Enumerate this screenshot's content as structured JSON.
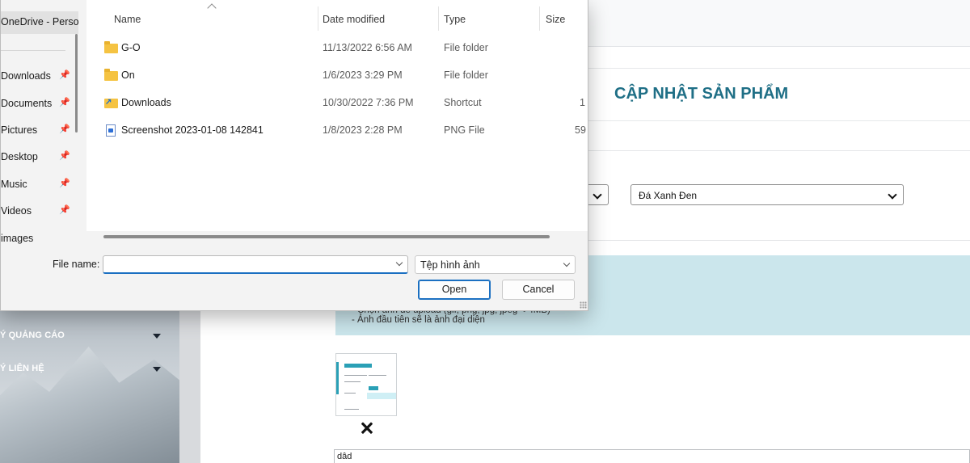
{
  "background": {
    "sidebar": {
      "items": [
        {
          "label": "Ý QUẢNG CÁO"
        },
        {
          "label": "Ý LIÊN HỆ"
        }
      ]
    },
    "page_title": "CẬP NHẬT SẢN PHẨM",
    "select_left": {
      "value": ""
    },
    "select_color": {
      "value": "Đá Xanh Đen"
    },
    "info_box": {
      "line1": "- Chọn ảnh để upload (gif, png, jpg, jpeg < 4MB)",
      "line2": "- Ảnh đầu tiên sẽ là ảnh đại diện"
    },
    "delete_symbol": "🗙",
    "text_field": {
      "value": "dâd"
    }
  },
  "dialog": {
    "nav": {
      "items": [
        {
          "label": "OneDrive - Perso",
          "pinned": false,
          "selected": true
        },
        {
          "label": "Downloads",
          "pinned": true
        },
        {
          "label": "Documents",
          "pinned": true
        },
        {
          "label": "Pictures",
          "pinned": true
        },
        {
          "label": "Desktop",
          "pinned": true
        },
        {
          "label": "Music",
          "pinned": true
        },
        {
          "label": "Videos",
          "pinned": true
        },
        {
          "label": "images",
          "pinned": false
        }
      ]
    },
    "columns": {
      "name": "Name",
      "date": "Date modified",
      "type": "Type",
      "size": "Size"
    },
    "files": [
      {
        "icon": "folder-icon",
        "name": "G-O",
        "date": "11/13/2022 6:56 AM",
        "type": "File folder",
        "size": ""
      },
      {
        "icon": "folder-icon",
        "name": "On",
        "date": "1/6/2023 3:29 PM",
        "type": "File folder",
        "size": ""
      },
      {
        "icon": "shortcut-icon",
        "name": "Downloads",
        "date": "10/30/2022 7:36 PM",
        "type": "Shortcut",
        "size": "1"
      },
      {
        "icon": "png-file-icon",
        "name": "Screenshot 2023-01-08 142841",
        "date": "1/8/2023 2:28 PM",
        "type": "PNG File",
        "size": "59"
      }
    ],
    "file_name_label": "File name:",
    "file_name_value": "",
    "file_type": "Tệp hình ảnh",
    "open_label": "Open",
    "cancel_label": "Cancel",
    "pin_glyph": "📌",
    "accent_color": "#1a6fc1"
  }
}
